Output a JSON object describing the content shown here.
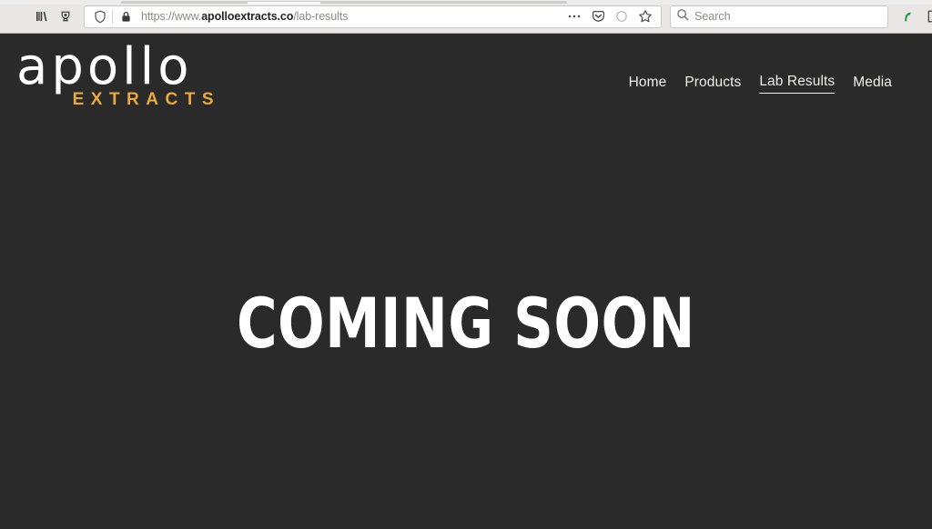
{
  "browser": {
    "left_icons": [
      {
        "name": "library-icon",
        "label": "Library"
      },
      {
        "name": "save-to-pocket-icon",
        "label": "Save to Pocket"
      }
    ],
    "url_bar": {
      "shield_icon": "shield-icon",
      "lock_icon": "lock-icon",
      "url_prefix": "https://www.",
      "url_host": "apolloextracts.co",
      "url_path": "/lab-results",
      "inline_icons": [
        {
          "name": "page-actions-ellipsis-icon",
          "label": "Page actions"
        },
        {
          "name": "pocket-icon",
          "label": "Save to Pocket"
        },
        {
          "name": "reader-mode-icon",
          "label": "Reader view"
        },
        {
          "name": "bookmark-star-icon",
          "label": "Bookmark this page"
        }
      ]
    },
    "search": {
      "icon": "search-icon",
      "placeholder": "Search",
      "value": ""
    },
    "right_icons": [
      {
        "name": "extension-green-arrow-icon",
        "label": "Extension",
        "color": "#2a9d4a"
      },
      {
        "name": "reading-list-icon",
        "label": "Reading list"
      }
    ]
  },
  "site": {
    "logo": {
      "wordmark": "apollo",
      "tagline": "EXTRACTS",
      "wordmark_color": "#ffffff",
      "tagline_color": "#e9a93a"
    },
    "nav": {
      "items": [
        {
          "label": "Home",
          "active": false
        },
        {
          "label": "Products",
          "active": false
        },
        {
          "label": "Lab Results",
          "active": true
        },
        {
          "label": "Media",
          "active": false
        }
      ]
    },
    "hero": {
      "heading": "COMING SOON"
    },
    "colors": {
      "background": "#2a2a2a",
      "text": "#ffffff",
      "accent": "#e9a93a"
    }
  }
}
